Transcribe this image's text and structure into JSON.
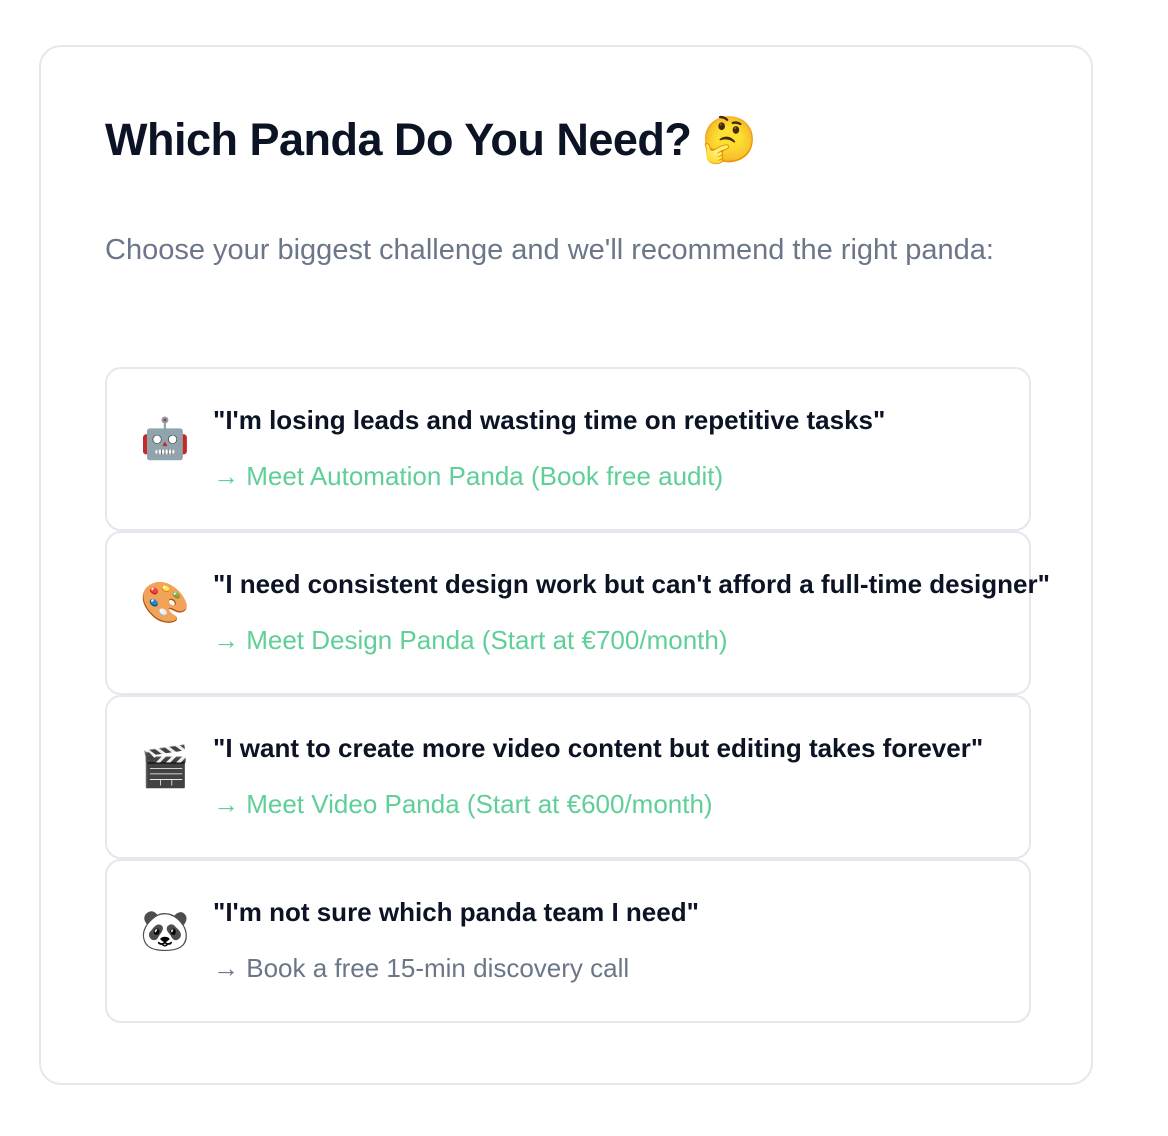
{
  "header": {
    "title": "Which Panda Do You Need?",
    "title_emoji": "🤔",
    "subtitle": "Choose your biggest challenge and we'll recommend the right panda:"
  },
  "options": [
    {
      "icon": "robot-icon",
      "emoji": "🤖",
      "quote": "\"I'm losing leads and wasting time on repetitive tasks\"",
      "cta": "→ Meet Automation Panda (Book free audit)"
    },
    {
      "icon": "palette-icon",
      "emoji": "🎨",
      "quote": "\"I need consistent design work but can't afford a full-time designer\"",
      "cta": "→ Meet Design Panda (Start at €700/month)"
    },
    {
      "icon": "clapper-board-icon",
      "emoji": "🎬",
      "quote": "\"I want to create more video content but editing takes forever\"",
      "cta": "→ Meet Video Panda (Start at €600/month)"
    },
    {
      "icon": "panda-icon",
      "emoji": "🐼",
      "quote": "\"I'm not sure which panda team I need\"",
      "cta": "→ Book a free 15-min discovery call"
    }
  ],
  "colors": {
    "accent_green": "#5fcf97",
    "muted_gray": "#6b7689",
    "heading": "#0b1324",
    "border": "#e4e7ec"
  }
}
